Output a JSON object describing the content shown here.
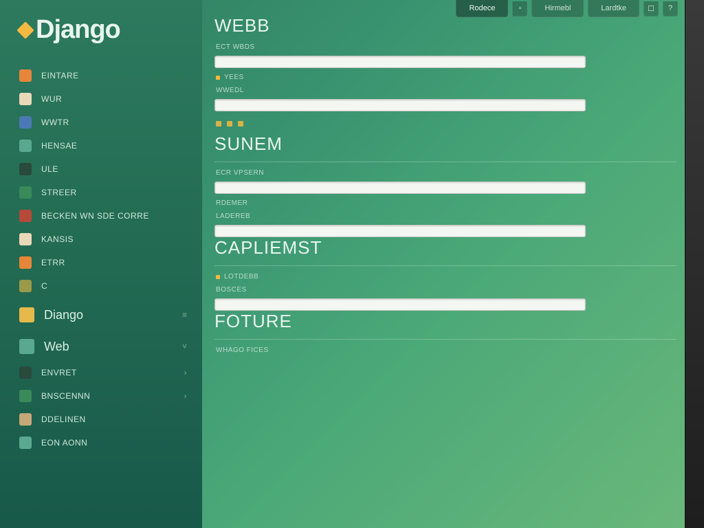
{
  "brand": "Django",
  "tabs": {
    "items": [
      "Rodece",
      "Hirmebl",
      "Lardtke"
    ],
    "active_index": 0
  },
  "sidebar": {
    "items": [
      {
        "label": "Eintare",
        "icon": "ic-orange"
      },
      {
        "label": "Wur",
        "icon": "ic-cream"
      },
      {
        "label": "Wwtr",
        "icon": "ic-blue"
      },
      {
        "label": "Hensae",
        "icon": "ic-teal"
      },
      {
        "label": "Ule",
        "icon": "ic-dark"
      },
      {
        "label": "Streer",
        "icon": "ic-green"
      },
      {
        "label": "Becken Wn Sde Corre",
        "icon": "ic-red"
      },
      {
        "label": "Kansis",
        "icon": "ic-cream"
      },
      {
        "label": "Etrr",
        "icon": "ic-orange"
      },
      {
        "label": "C",
        "icon": "ic-olive"
      }
    ],
    "sections": [
      {
        "label": "Diango",
        "icon": "ic-yellow",
        "caret": "≡"
      },
      {
        "label": "Web",
        "icon": "ic-teal",
        "caret": "˅"
      }
    ],
    "footer_items": [
      {
        "label": "Envret",
        "icon": "ic-dark",
        "caret": "›"
      },
      {
        "label": "Bnscennn",
        "icon": "ic-green",
        "caret": "›"
      },
      {
        "label": "Ddelinen",
        "icon": "ic-tan"
      },
      {
        "label": "Eon Aonn",
        "icon": "ic-teal"
      }
    ]
  },
  "form": {
    "sections": [
      {
        "title": "Webb",
        "fields": [
          {
            "label": "Ect Wbds",
            "value": "",
            "dot": false
          },
          {
            "label": "Yees",
            "value": "",
            "dot": true,
            "noinput": true
          },
          {
            "label": "Wwedl",
            "value": ""
          }
        ]
      },
      {
        "title": "Sunem",
        "fields": [
          {
            "label": "Ecr Vpsern",
            "value": ""
          },
          {
            "label": "Rdemer",
            "value": "",
            "noinput": true
          },
          {
            "label": "Ladereb",
            "value": ""
          }
        ]
      },
      {
        "title": "Capliemst",
        "fields": [
          {
            "label": "Lotdebb",
            "value": "",
            "dot": true,
            "noinput": true
          },
          {
            "label": "Bosces",
            "value": ""
          }
        ]
      },
      {
        "title": "Foture",
        "fields": [
          {
            "label": "Whago Fices",
            "value": "",
            "noinput": true
          }
        ]
      }
    ]
  }
}
